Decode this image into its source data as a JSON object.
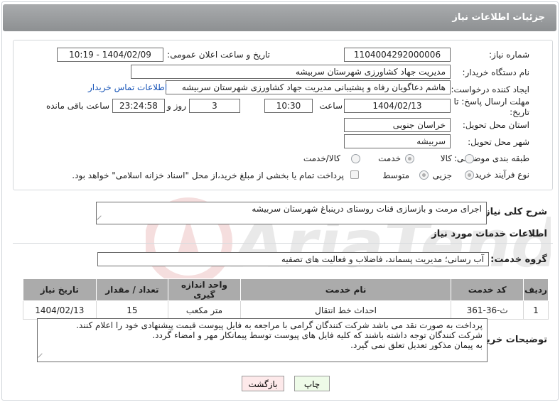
{
  "header": {
    "title": "جزئیات اطلاعات نیاز"
  },
  "form": {
    "need_number_label": "شماره نیاز:",
    "need_number": "1104004292000006",
    "announce_label": "تاریخ و ساعت اعلان عمومی:",
    "announce_value": "1404/02/09 - 10:19",
    "buyer_org_label": "نام دستگاه خریدار:",
    "buyer_org": "مدیریت جهاد کشاورزی شهرستان سربیشه",
    "requester_label": "ایجاد کننده درخواست:",
    "requester": "هاشم دعاگویان  رفاه و پشتیبانی مدیریت جهاد کشاورزی شهرستان سربیشه",
    "buyer_contact_link": "اطلاعات تماس خریدار",
    "deadline_label": "مهلت ارسال پاسخ: تا تاریخ:",
    "deadline_date": "1404/02/13",
    "time_label": "ساعت",
    "deadline_time": "10:30",
    "days_value": "3",
    "days_label": "روز و",
    "remaining_time": "23:24:58",
    "remaining_label": "ساعت باقی مانده",
    "province_label": "استان محل تحویل:",
    "province": "خراسان جنوبی",
    "city_label": "شهر محل تحویل:",
    "city": "سربیشه",
    "category_label": "طبقه بندی موضوعی:",
    "category_options": [
      "کالا",
      "خدمت",
      "کالا/خدمت"
    ],
    "purchase_type_label": "نوع فرآیند خرید :",
    "purchase_options": [
      "جزیی",
      "متوسط"
    ],
    "payment_note": "پرداخت تمام یا بخشی از مبلغ خرید،از محل \"اسناد خزانه اسلامی\" خواهد بود."
  },
  "summary": {
    "label": "شرح کلی نیاز:",
    "text": "اجرای مرمت و بازسازی قنات روستای درینباغ شهرستان سربیشه"
  },
  "services": {
    "section_title": "اطلاعات خدمات مورد نیاز",
    "group_label": "گروه خدمت:",
    "group_value": "آب رسانی؛ مدیریت پسماند، فاضلاب و فعالیت های تصفیه",
    "columns": [
      "ردیف",
      "کد خدمت",
      "نام خدمت",
      "واحد اندازه گیری",
      "تعداد / مقدار",
      "تاریخ نیاز"
    ],
    "rows": [
      [
        "1",
        "ث-36-361",
        "احداث خط انتقال",
        "متر مکعب",
        "15",
        "1404/02/13"
      ]
    ]
  },
  "buyer_notes": {
    "label": "توضیحات خریدار:",
    "lines": [
      "پرداخت به صورت نقد می باشد شرکت کنندگان گرامی با مراجعه به فایل پیوست قیمت پیشنهادی خود را اعلام کنند.",
      "شرکت کنندگان توجه داشته باشند که کلیه فایل های پیوست توسط پیمانکار مهر و امضاء گردد.",
      "به پیمان مذکور تعدیل تعلق نمی گیرد."
    ]
  },
  "buttons": {
    "print": "چاپ",
    "back": "بازگشت"
  },
  "colors": {
    "link": "#1a56b8",
    "header": "#9a9c9e",
    "back_button": "#fde9ea",
    "print_button": "#eefbe8"
  }
}
